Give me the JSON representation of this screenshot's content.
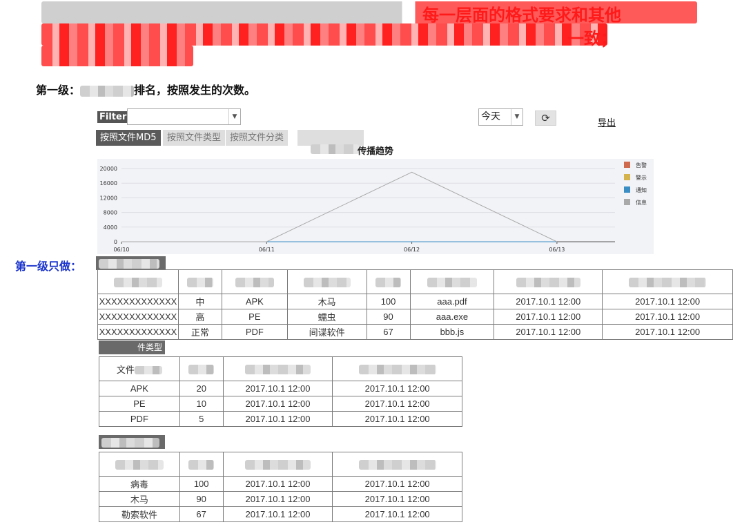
{
  "notes": {
    "line1_visible": "每一层面的格式要求和其他",
    "line2_visible": "一致；"
  },
  "level1": {
    "prefix": "第一级：",
    "suffix": "排名，按照发生的次数。"
  },
  "level1_only": "第一级只做：",
  "toolbar": {
    "filter_label": "Filter",
    "filter_value": "",
    "range_value": "今天",
    "refresh_icon": "refresh-icon",
    "export_label": "导出"
  },
  "tabs": [
    {
      "label": "按照文件MD5",
      "active": true
    },
    {
      "label": "按照文件类型",
      "active": false
    },
    {
      "label": "按照文件分类",
      "active": false
    },
    {
      "label": "",
      "active": false
    }
  ],
  "chart_title": "传播趋势",
  "chart_data": {
    "type": "line",
    "title": "传播趋势",
    "x": [
      "06/10",
      "06/11",
      "06/12",
      "06/13"
    ],
    "ylim": [
      0,
      20000
    ],
    "yticks": [
      0,
      4000,
      8000,
      12000,
      16000,
      20000
    ],
    "legend_position": "top-right",
    "series": [
      {
        "name": "告警",
        "color": "#d06a4e",
        "values": [
          0,
          0,
          0,
          0
        ]
      },
      {
        "name": "警示",
        "color": "#d4b24c",
        "values": [
          0,
          0,
          0,
          0
        ]
      },
      {
        "name": "通知",
        "color": "#3b8ec4",
        "values": [
          0,
          0,
          0,
          0
        ]
      },
      {
        "name": "信息",
        "color": "#a9a9a9",
        "values": [
          0,
          0,
          19000,
          0
        ]
      }
    ]
  },
  "table_md5": {
    "rows": [
      [
        "XXXXXXXXXXXXX",
        "中",
        "APK",
        "木马",
        "100",
        "aaa.pdf",
        "2017.10.1 12:00",
        "2017.10.1 12:00"
      ],
      [
        "XXXXXXXXXXXXX",
        "高",
        "PE",
        "蠕虫",
        "90",
        "aaa.exe",
        "2017.10.1 12:00",
        "2017.10.1 12:00"
      ],
      [
        "XXXXXXXXXXXXX",
        "正常",
        "PDF",
        "间谍软件",
        "67",
        "bbb.js",
        "2017.10.1 12:00",
        "2017.10.1 12:00"
      ]
    ]
  },
  "section_type_label": "件类型",
  "table_type": {
    "header_first": "文件",
    "rows": [
      [
        "APK",
        "20",
        "2017.10.1 12:00",
        "2017.10.1 12:00"
      ],
      [
        "PE",
        "10",
        "2017.10.1 12:00",
        "2017.10.1 12:00"
      ],
      [
        "PDF",
        "5",
        "2017.10.1 12:00",
        "2017.10.1 12:00"
      ]
    ]
  },
  "table_category": {
    "rows": [
      [
        "病毒",
        "100",
        "2017.10.1 12:00",
        "2017.10.1 12:00"
      ],
      [
        "木马",
        "90",
        "2017.10.1 12:00",
        "2017.10.1 12:00"
      ],
      [
        "勒索软件",
        "67",
        "2017.10.1 12:00",
        "2017.10.1 12:00"
      ]
    ]
  }
}
